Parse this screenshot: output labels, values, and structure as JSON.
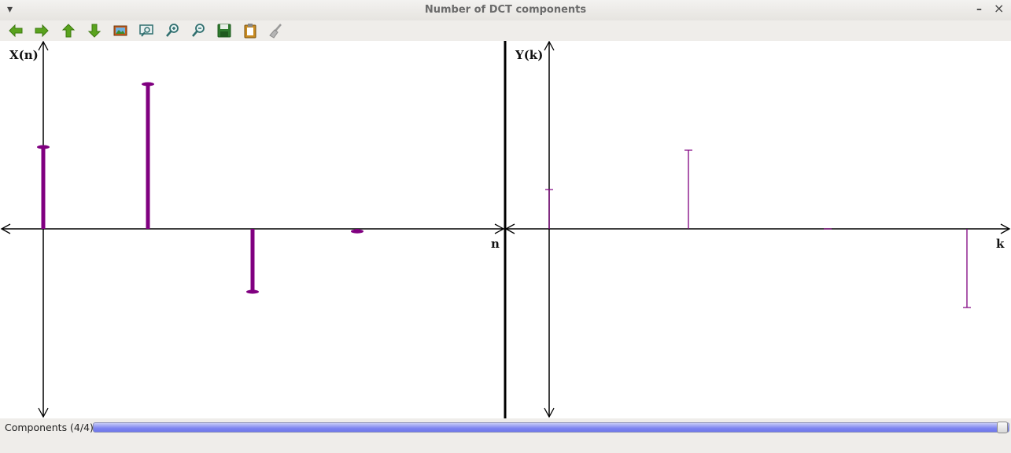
{
  "window": {
    "title": "Number of DCT components",
    "minimize_label": "–",
    "close_label": "×"
  },
  "toolbar": {
    "tools": [
      {
        "name": "back-icon"
      },
      {
        "name": "forward-icon"
      },
      {
        "name": "up-icon"
      },
      {
        "name": "down-icon"
      },
      {
        "name": "image-icon"
      },
      {
        "name": "zoom-region-icon"
      },
      {
        "name": "zoom-in-icon"
      },
      {
        "name": "zoom-out-icon"
      },
      {
        "name": "save-icon"
      },
      {
        "name": "clipboard-icon"
      },
      {
        "name": "clear-brush-icon"
      }
    ]
  },
  "chart_data": [
    {
      "type": "stem",
      "ylabel": "X(n)",
      "xlabel": "n",
      "x": [
        0,
        1,
        2,
        3
      ],
      "values": [
        1.3,
        2.3,
        -1.0,
        -0.04
      ],
      "ylim": [
        -3.0,
        3.0
      ],
      "color": "#800080"
    },
    {
      "type": "stem",
      "ylabel": "Y(k)",
      "xlabel": "k",
      "x": [
        0,
        1,
        2,
        3
      ],
      "values": [
        0.5,
        1.0,
        0.0,
        -1.0
      ],
      "ylim": [
        -2.4,
        2.4
      ],
      "color": "#800080"
    }
  ],
  "status": {
    "components_label": "Components (4/4)",
    "slider_value": 1.0
  }
}
